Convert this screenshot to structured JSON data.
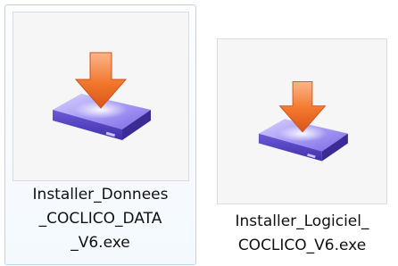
{
  "files": [
    {
      "name_lines": [
        "Installer_Donnees",
        "_COCLICO_DATA",
        "_V6.exe"
      ],
      "icon": "installer-disk-icon",
      "selected": true
    },
    {
      "name_lines": [
        "Installer_Logiciel_",
        "COCLICO_V6.exe"
      ],
      "icon": "installer-disk-icon",
      "selected": false
    }
  ],
  "colors": {
    "selection_border": "#b8d6ee",
    "arrow": "#f07a2c",
    "disk": "#7b6fe0"
  }
}
